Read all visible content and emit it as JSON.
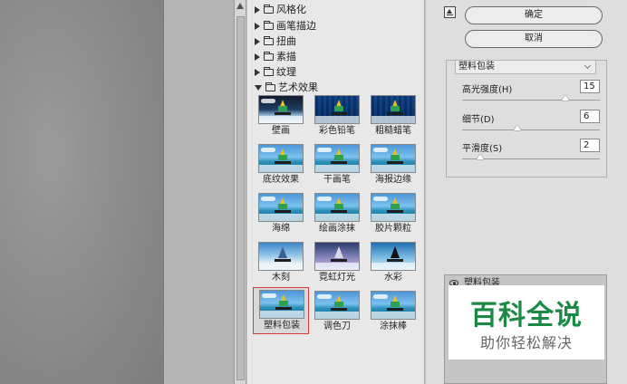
{
  "gallery": {
    "categories": [
      {
        "label": "风格化",
        "expanded": false
      },
      {
        "label": "画笔描边",
        "expanded": false
      },
      {
        "label": "扭曲",
        "expanded": false
      },
      {
        "label": "素描",
        "expanded": false
      },
      {
        "label": "纹理",
        "expanded": false
      },
      {
        "label": "艺术效果",
        "expanded": true
      }
    ],
    "filters": [
      {
        "label": "壁画",
        "icon": "fresco-thumbnail"
      },
      {
        "label": "彩色铅笔",
        "icon": "colored-pencil-thumbnail"
      },
      {
        "label": "粗糙蜡笔",
        "icon": "rough-pastels-thumbnail"
      },
      {
        "label": "底纹效果",
        "icon": "underpainting-thumbnail"
      },
      {
        "label": "干画笔",
        "icon": "dry-brush-thumbnail"
      },
      {
        "label": "海报边缘",
        "icon": "poster-edges-thumbnail"
      },
      {
        "label": "海绵",
        "icon": "sponge-thumbnail"
      },
      {
        "label": "绘画涂抹",
        "icon": "paint-daubs-thumbnail"
      },
      {
        "label": "胶片颗粒",
        "icon": "film-grain-thumbnail"
      },
      {
        "label": "木刻",
        "icon": "cutout-thumbnail"
      },
      {
        "label": "霓虹灯光",
        "icon": "neon-glow-thumbnail"
      },
      {
        "label": "水彩",
        "icon": "watercolor-thumbnail"
      },
      {
        "label": "塑料包装",
        "icon": "plastic-wrap-thumbnail",
        "selected": true
      },
      {
        "label": "调色刀",
        "icon": "palette-knife-thumbnail"
      },
      {
        "label": "涂抹棒",
        "icon": "smudge-stick-thumbnail"
      }
    ]
  },
  "panel": {
    "ok_label": "确定",
    "cancel_label": "取消",
    "selected_filter": "塑料包装",
    "params": [
      {
        "label": "高光强度(H)",
        "value": "15",
        "max": 20
      },
      {
        "label": "细节(D)",
        "value": "6",
        "max": 15
      },
      {
        "label": "平滑度(S)",
        "value": "2",
        "max": 15
      }
    ],
    "layer_name": "塑料包装"
  },
  "watermark": {
    "title": "百科全说",
    "subtitle": "助你轻松解决"
  },
  "colors": {
    "selection_border": "#d73b3b",
    "watermark_green": "#1a8a45"
  }
}
